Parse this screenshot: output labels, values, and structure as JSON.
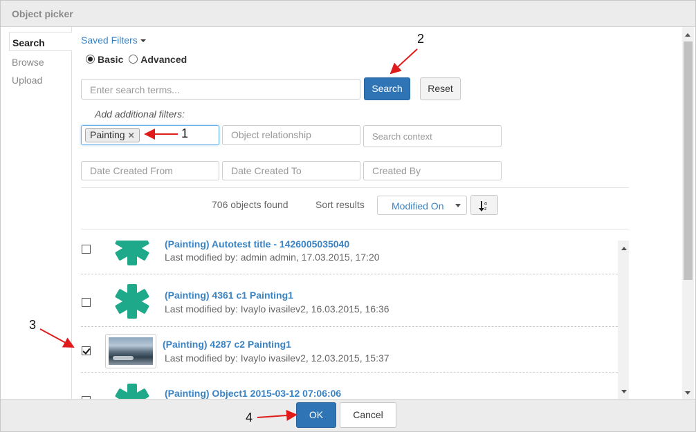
{
  "dialog": {
    "title": "Object picker"
  },
  "sidebar": {
    "tabs": [
      "Search",
      "Browse",
      "Upload"
    ]
  },
  "filters": {
    "saved_filters_label": "Saved Filters",
    "mode_basic": "Basic",
    "mode_advanced": "Advanced",
    "search_placeholder": "Enter search terms...",
    "search_button": "Search",
    "reset_button": "Reset",
    "add_filters_label": "Add additional filters:",
    "tag_painting": "Painting",
    "object_relationship_placeholder": "Object relationship",
    "search_context_placeholder": "Search context",
    "date_from_placeholder": "Date Created From",
    "date_to_placeholder": "Date Created To",
    "created_by_placeholder": "Created By"
  },
  "results_bar": {
    "found_text": "706 objects found",
    "sort_label": "Sort results",
    "sort_value": "Modified On"
  },
  "results": [
    {
      "title": "(Painting) Autotest title - 1426005035040",
      "meta": "Last modified by: admin admin, 17.03.2015, 17:20",
      "checked": false,
      "thumb": "asterisk-icon"
    },
    {
      "title": "(Painting) 4361 c1 Painting1",
      "meta": "Last modified by: Ivaylo ivasilev2, 16.03.2015, 16:36",
      "checked": false,
      "thumb": "asterisk-icon"
    },
    {
      "title": "(Painting) 4287 c2 Painting1",
      "meta": "Last modified by: Ivaylo ivasilev2, 12.03.2015, 15:37",
      "checked": true,
      "thumb": "landscape-photo"
    },
    {
      "title": "(Painting) Object1 2015-03-12 07:06:06",
      "meta": "",
      "checked": false,
      "thumb": "asterisk-icon"
    }
  ],
  "footer": {
    "ok_button": "OK",
    "cancel_button": "Cancel"
  },
  "annotations": [
    "1",
    "2",
    "3",
    "4"
  ],
  "colors": {
    "accent": "#2f74b5",
    "link": "#3a83c4",
    "thumb_teal": "#1fa98b",
    "annotation_arrow": "#e01b1b"
  }
}
